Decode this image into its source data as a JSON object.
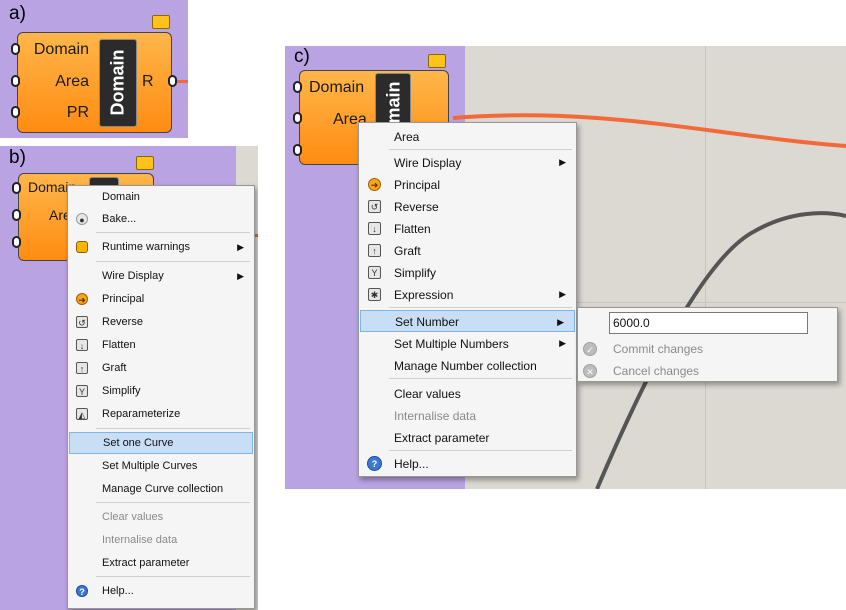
{
  "panels": {
    "a": {
      "label": "a)"
    },
    "b": {
      "label": "b)"
    },
    "c": {
      "label": "c)"
    }
  },
  "component": {
    "inputs": [
      "Domain",
      "Area",
      "PR"
    ],
    "badge": "Domain",
    "output": "R"
  },
  "component_c": {
    "badge_partial": "main"
  },
  "menu_b": {
    "items": [
      {
        "label": "Domain",
        "icon": ""
      },
      {
        "label": "Bake...",
        "icon": "bake-icon"
      },
      {
        "label": "Runtime warnings",
        "icon": "warning-icon",
        "submenu": true
      },
      {
        "label": "Wire Display",
        "icon": "",
        "submenu": true
      },
      {
        "label": "Principal",
        "icon": "principal-icon"
      },
      {
        "label": "Reverse",
        "icon": "reverse-icon"
      },
      {
        "label": "Flatten",
        "icon": "flatten-icon"
      },
      {
        "label": "Graft",
        "icon": "graft-icon"
      },
      {
        "label": "Simplify",
        "icon": "simplify-icon"
      },
      {
        "label": "Reparameterize",
        "icon": "reparameterize-icon"
      },
      {
        "label": "Set one Curve",
        "icon": "",
        "selected": true
      },
      {
        "label": "Set Multiple Curves",
        "icon": ""
      },
      {
        "label": "Manage Curve collection",
        "icon": ""
      },
      {
        "label": "Clear values",
        "icon": "",
        "disabled": true
      },
      {
        "label": "Internalise data",
        "icon": "",
        "disabled": true
      },
      {
        "label": "Extract parameter",
        "icon": ""
      },
      {
        "label": "Help...",
        "icon": "help-icon"
      }
    ]
  },
  "menu_c": {
    "items": [
      {
        "label": "Area",
        "icon": ""
      },
      {
        "label": "Wire Display",
        "icon": "",
        "submenu": true
      },
      {
        "label": "Principal",
        "icon": "principal-icon"
      },
      {
        "label": "Reverse",
        "icon": "reverse-icon"
      },
      {
        "label": "Flatten",
        "icon": "flatten-icon"
      },
      {
        "label": "Graft",
        "icon": "graft-icon"
      },
      {
        "label": "Simplify",
        "icon": "simplify-icon"
      },
      {
        "label": "Expression",
        "icon": "expression-icon",
        "submenu": true
      },
      {
        "label": "Set Number",
        "icon": "",
        "submenu": true,
        "selected": true
      },
      {
        "label": "Set Multiple Numbers",
        "icon": "",
        "submenu": true
      },
      {
        "label": "Manage Number collection",
        "icon": ""
      },
      {
        "label": "Clear values",
        "icon": ""
      },
      {
        "label": "Internalise data",
        "icon": "",
        "disabled": true
      },
      {
        "label": "Extract parameter",
        "icon": ""
      },
      {
        "label": "Help...",
        "icon": "help-icon"
      }
    ],
    "submenu": {
      "value": "6000.0",
      "commit": "Commit changes",
      "cancel": "Cancel changes"
    }
  },
  "colors": {
    "canvas_purple": "#b9a3e3",
    "canvas_gray": "#dcd9d2",
    "wire_orange": "#f26a3a",
    "curve_dark": "#555555",
    "selection": "#c7def4"
  }
}
